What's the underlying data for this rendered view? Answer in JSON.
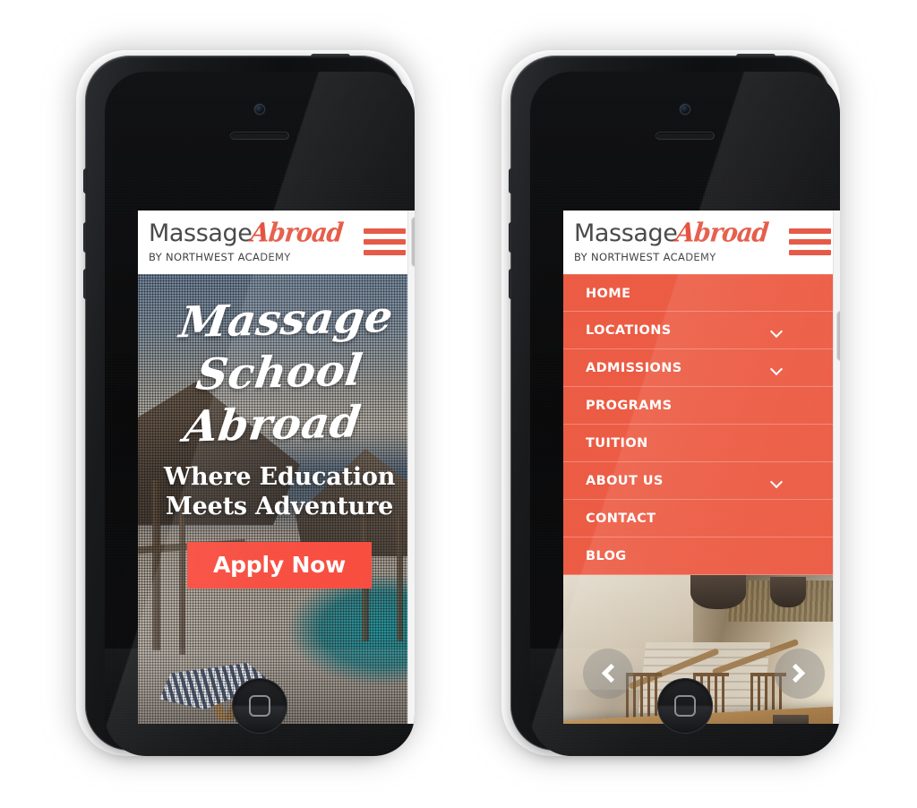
{
  "page": {
    "title": "Massage Abroad mobile site — two iPhone mockups",
    "brand_color": "#e4533f",
    "menu_color": "#ec5b43",
    "cta_color": "#f7483a"
  },
  "header": {
    "logo_part1": "Massage",
    "logo_part2": "Abroad",
    "tagline": "BY NORTHWEST ACADEMY",
    "menu_icon": "hamburger-icon"
  },
  "phone_left": {
    "hero": {
      "script_line1": "Massage School",
      "script_line2": "Abroad",
      "subtitle_line1": "Where Education",
      "subtitle_line2": "Meets Adventure",
      "cta_label": "Apply Now"
    },
    "scrollbar": {
      "thumb_position": "top"
    }
  },
  "phone_right": {
    "nav_items": [
      {
        "label": "HOME",
        "has_submenu": false
      },
      {
        "label": "LOCATIONS",
        "has_submenu": true
      },
      {
        "label": "ADMISSIONS",
        "has_submenu": true
      },
      {
        "label": "PROGRAMS",
        "has_submenu": false
      },
      {
        "label": "TUITION",
        "has_submenu": false
      },
      {
        "label": "ABOUT US",
        "has_submenu": true
      },
      {
        "label": "CONTACT",
        "has_submenu": false
      },
      {
        "label": "BLOG",
        "has_submenu": false
      }
    ],
    "carousel": {
      "prev_icon": "chevron-left-icon",
      "next_icon": "chevron-right-icon"
    },
    "scrollbar": {
      "thumb_position": "upper-middle"
    }
  }
}
